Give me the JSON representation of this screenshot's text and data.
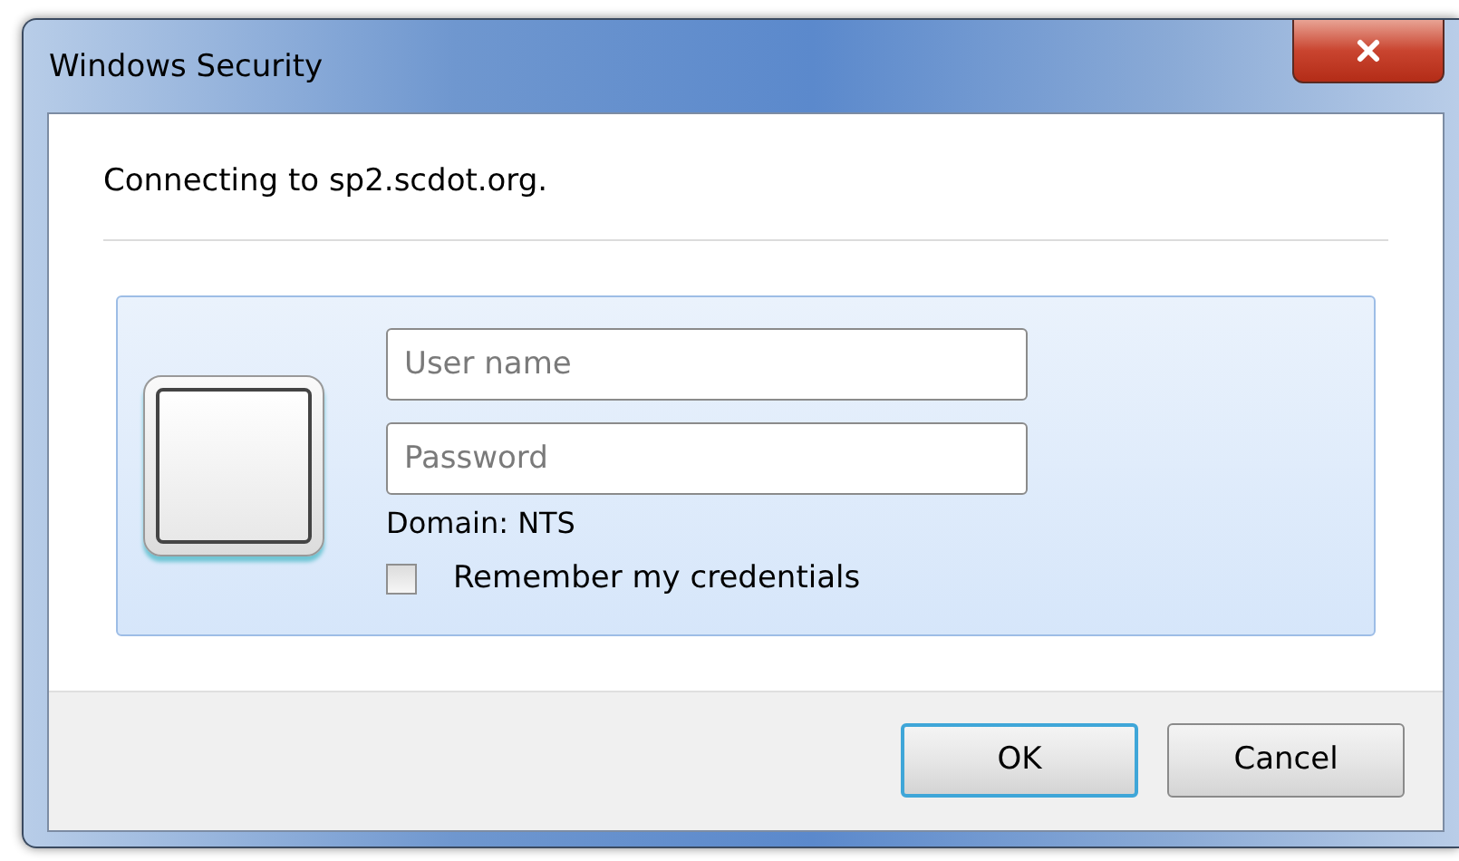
{
  "window": {
    "title": "Windows Security"
  },
  "message": "Connecting to sp2.scdot.org.",
  "credentials": {
    "username": {
      "placeholder": "User name"
    },
    "password": {
      "placeholder": "Password"
    },
    "domain": "Domain: NTS",
    "remember": {
      "label": "Remember my credentials",
      "checked": false
    }
  },
  "buttons": [
    {
      "label": "OK",
      "default": true
    },
    {
      "label": "Cancel",
      "default": false
    }
  ]
}
